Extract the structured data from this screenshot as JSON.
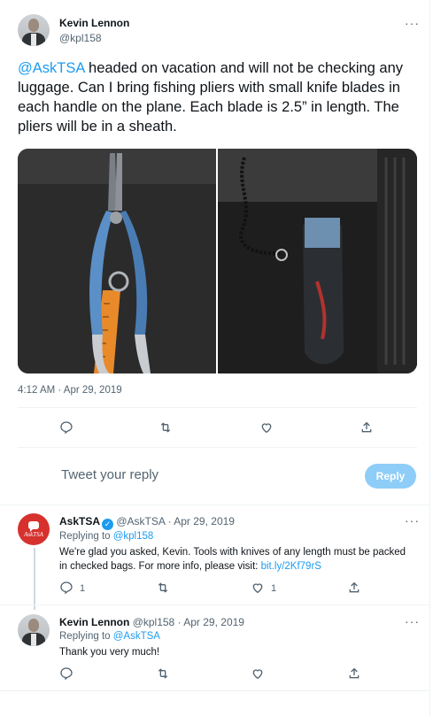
{
  "main_tweet": {
    "author_name": "Kevin Lennon",
    "author_handle": "@kpl158",
    "text_mention": "@AskTSA",
    "text_body": " headed on vacation and will not be checking any luggage.  Can I bring fishing pliers with small knife blades in each handle on the plane. Each blade is 2.5” in length.  The pliers will be in a sheath.",
    "timestamp": "4:12 AM · Apr 29, 2019",
    "more_label": "···"
  },
  "compose": {
    "placeholder": "Tweet your reply",
    "reply_button": "Reply"
  },
  "replies": [
    {
      "author_name": "AskTSA",
      "author_handle": "@AskTSA",
      "date": "· Apr 29, 2019",
      "replying_to_label": "Replying to ",
      "replying_to": "@kpl158",
      "text": "We're glad you asked, Kevin. Tools with knives of any length must be packed in checked bags. For more info, please visit: ",
      "link": "bit.ly/2Kf79rS",
      "avatar_text": "AskTSA",
      "reply_count": "1",
      "like_count": "1"
    },
    {
      "author_name": "Kevin Lennon",
      "author_handle": "@kpl158",
      "date": "· Apr 29, 2019",
      "replying_to_label": "Replying to ",
      "replying_to": "@AskTSA",
      "text": "Thank you very much!"
    }
  ],
  "icons": [
    "reply-icon",
    "retweet-icon",
    "like-icon",
    "share-icon",
    "more-icon",
    "verified-icon"
  ],
  "colors": {
    "accent": "#1d9bf0",
    "asktsa_red": "#d7312e",
    "muted": "#536471"
  }
}
